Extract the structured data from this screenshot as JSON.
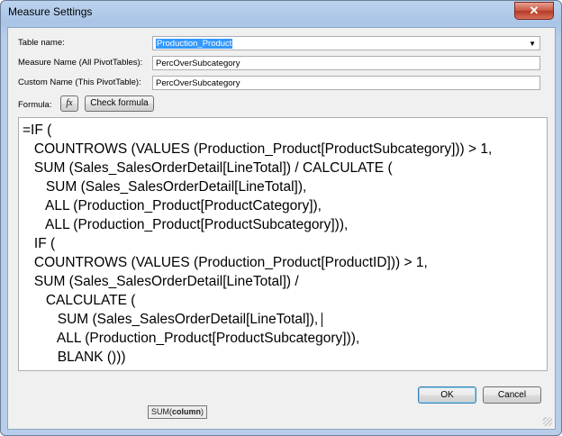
{
  "window": {
    "title": "Measure Settings",
    "close_label": "✕"
  },
  "form": {
    "table_name_label": "Table name:",
    "table_name_value": "Production_Product",
    "measure_name_label": "Measure Name (All PivotTables):",
    "measure_name_value": "PercOverSubcategory",
    "custom_name_label": "Custom Name (This PivotTable):",
    "custom_name_value": "PercOverSubcategory",
    "formula_label": "Formula:",
    "fx_label": "fx",
    "check_formula_label": "Check formula"
  },
  "formula_lines": [
    "=IF (",
    "   COUNTROWS (VALUES (Production_Product[ProductSubcategory])) > 1,",
    "   SUM (Sales_SalesOrderDetail[LineTotal]) / CALCULATE (",
    "      SUM (Sales_SalesOrderDetail[LineTotal]),",
    "      ALL (Production_Product[ProductCategory]),",
    "      ALL (Production_Product[ProductSubcategory])),",
    "   IF (",
    "   COUNTROWS (VALUES (Production_Product[ProductID])) > 1,",
    "   SUM (Sales_SalesOrderDetail[LineTotal]) /",
    "      CALCULATE (",
    "         SUM (Sales_SalesOrderDetail[LineTotal]),",
    "         ALL (Production_Product[ProductSubcategory])),",
    "         BLANK ()))"
  ],
  "buttons": {
    "ok": "OK",
    "cancel": "Cancel"
  },
  "tooltip": {
    "func": "SUM(",
    "arg": "column",
    "close": ")"
  },
  "icons": {
    "close": "close-icon",
    "fx": "function-icon",
    "dropdown": "chevron-down-icon"
  }
}
